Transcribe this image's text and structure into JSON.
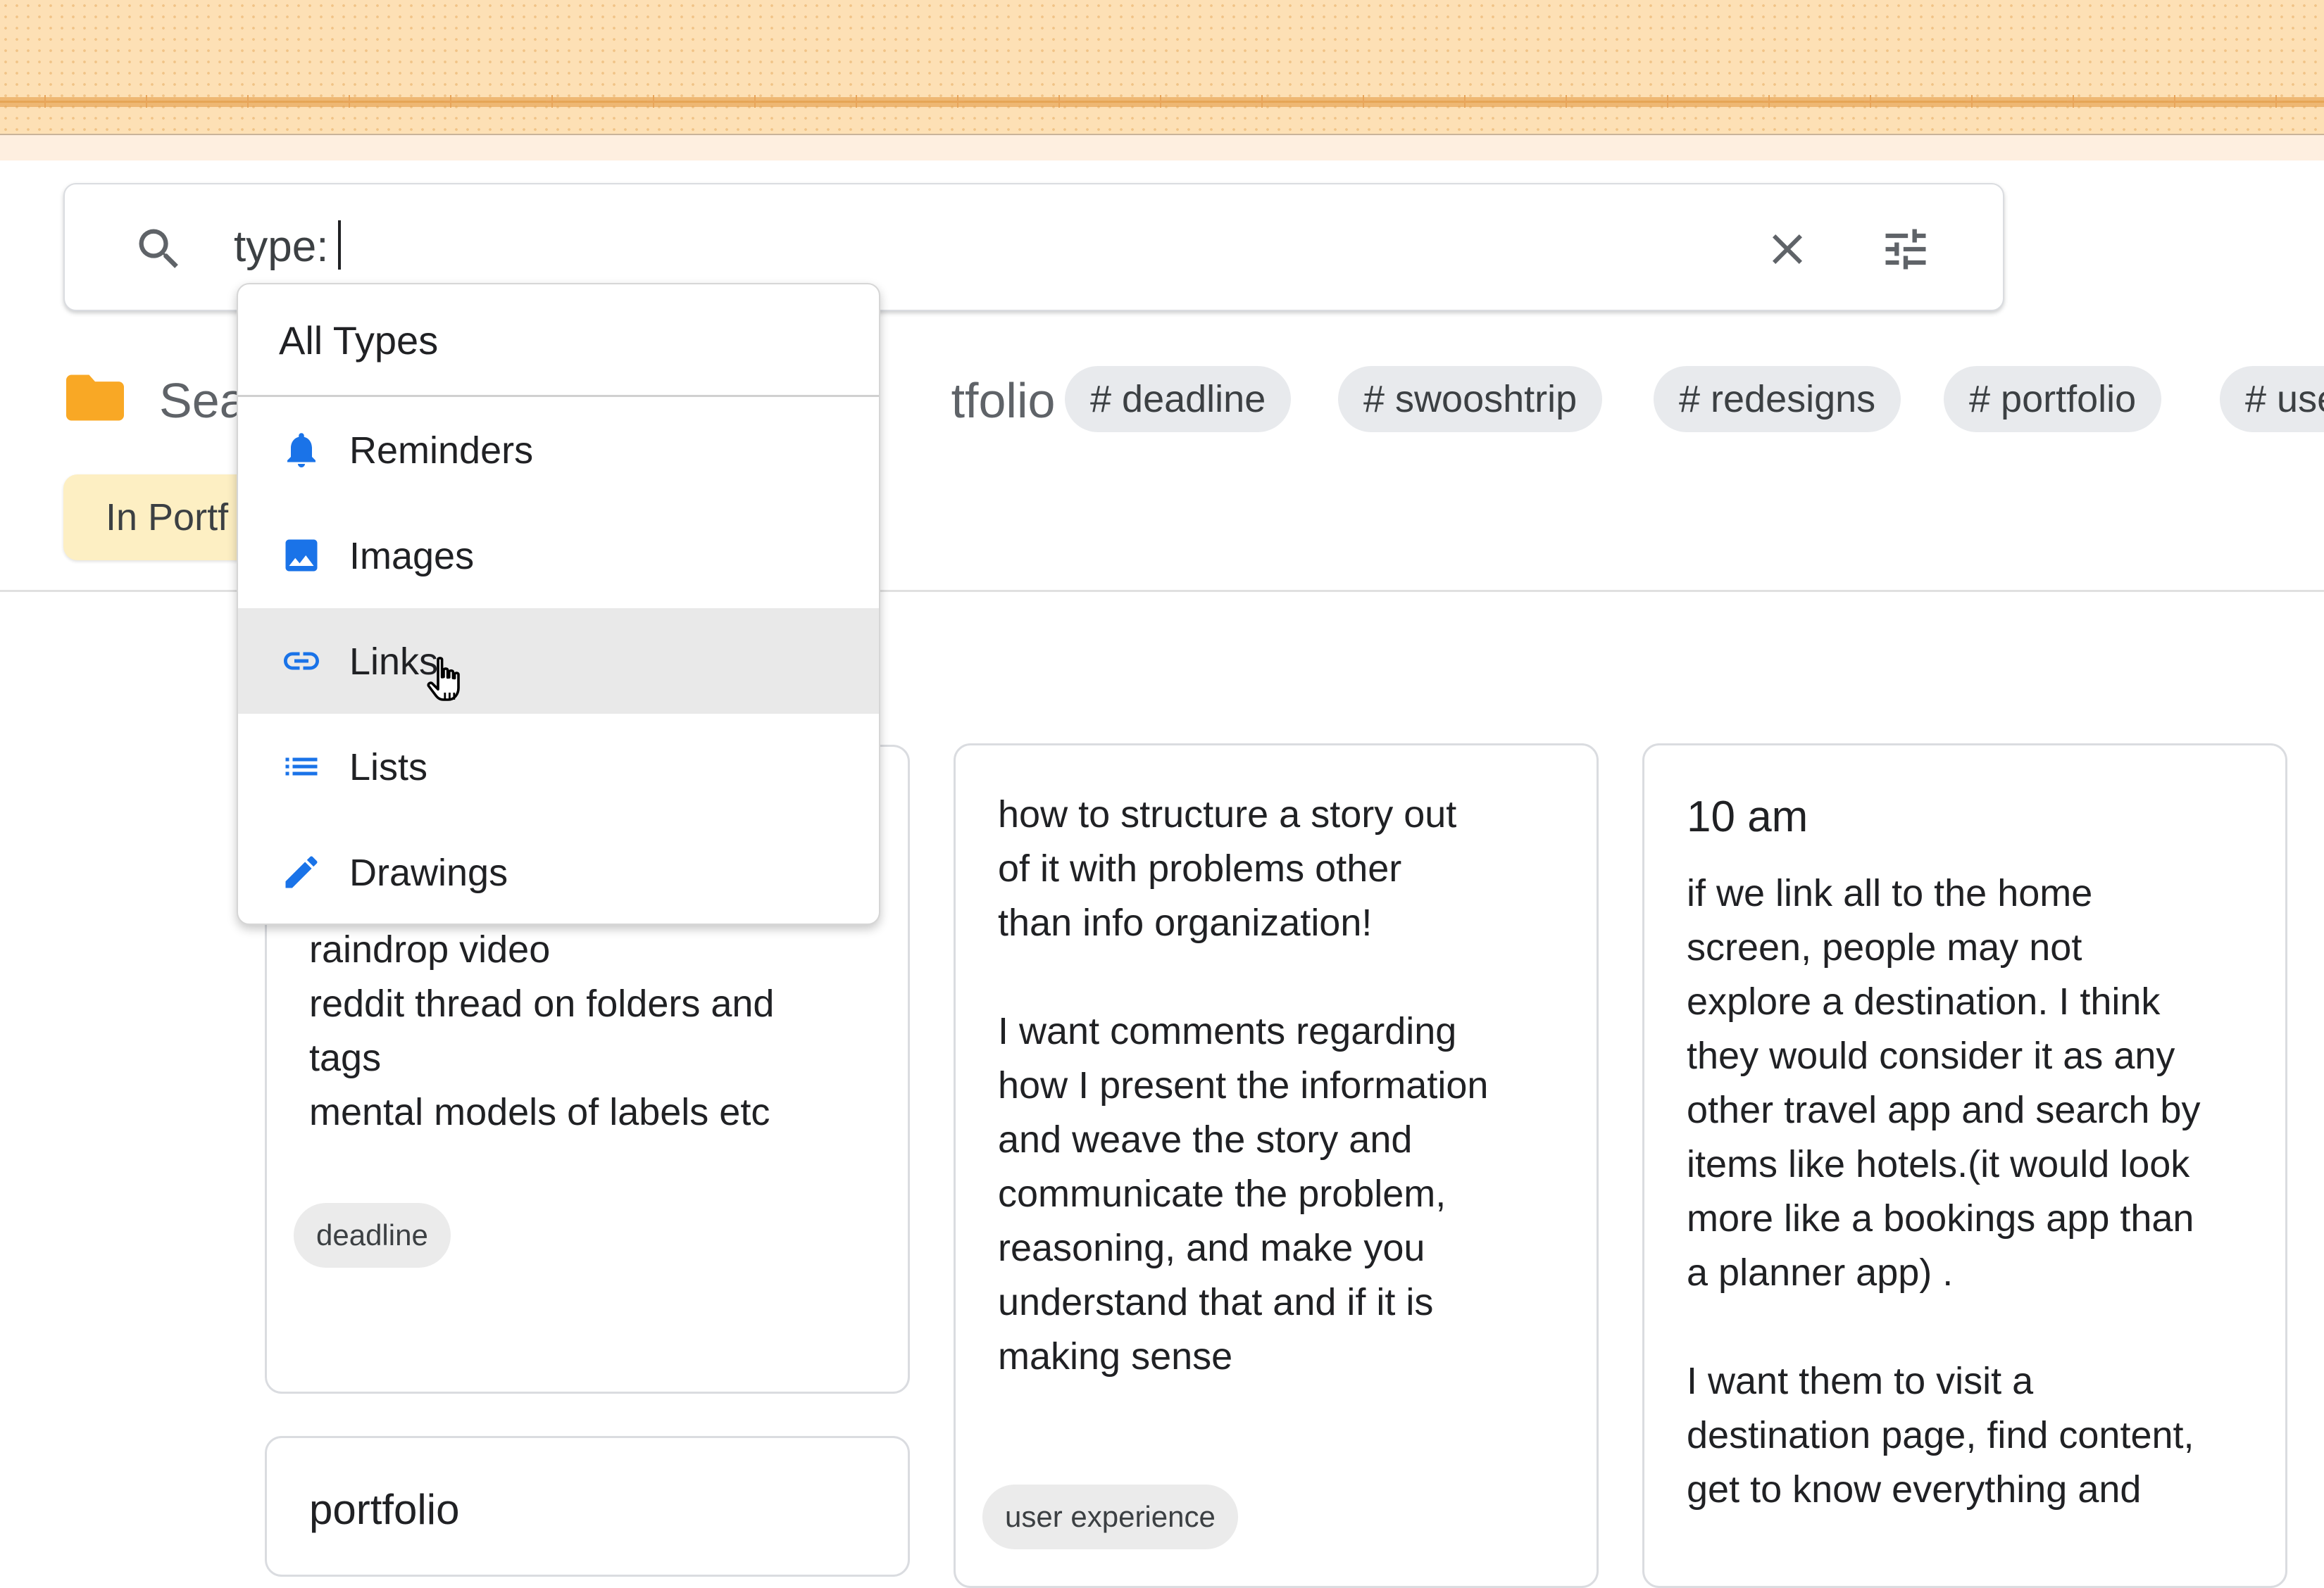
{
  "search": {
    "query": "type:",
    "clear_icon": "close-icon",
    "filter_icon": "tune-icon"
  },
  "breadcrumb": {
    "title_start": "Sea",
    "title_end": "tfolio",
    "tags": [
      "# deadline",
      "# swooshtrip",
      "# redesigns",
      "# portfolio",
      "# use"
    ]
  },
  "filter_chip": {
    "label": "In Portf"
  },
  "type_dropdown": {
    "header": "All Types",
    "items": [
      {
        "label": "Reminders",
        "icon": "bell-icon"
      },
      {
        "label": "Images",
        "icon": "image-icon"
      },
      {
        "label": "Links",
        "icon": "link-icon"
      },
      {
        "label": "Lists",
        "icon": "list-icon"
      },
      {
        "label": "Drawings",
        "icon": "pen-icon"
      }
    ],
    "hovered": "Links"
  },
  "cards": [
    {
      "body": "raindrop video\nreddit thread on folders and\ntags\nmental models of labels etc",
      "label": "deadline"
    },
    {
      "title": "portfolio"
    },
    {
      "body": "how to structure a story out\nof it with problems other\nthan info organization!\n\nI want comments regarding\nhow I present the information\nand weave the story and\ncommunicate the problem,\nreasoning, and make you\nunderstand that and if it is\nmaking sense",
      "label": "user experience"
    },
    {
      "title": "10 am",
      "body": "if we link all to the home\nscreen, people may not\nexplore a destination. I think\nthey would consider it as any\nother travel app and search by\nitems like hotels.(it would look\nmore like a bookings app than\na planner app) .\n\nI want them to visit a\ndestination page, find content,\nget to know everything and"
    }
  ],
  "colors": {
    "banner": "#fde0b5",
    "accent_blue": "#1a73e8",
    "folder_orange": "#f9a825",
    "chip_bg": "#e8eaed",
    "filter_chip_bg": "#fdefc3"
  }
}
